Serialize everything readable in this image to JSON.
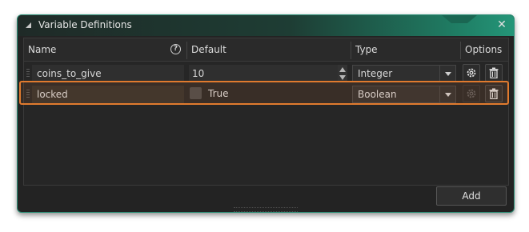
{
  "window": {
    "title": "Variable Definitions"
  },
  "table": {
    "columns": {
      "name": "Name",
      "default": "Default",
      "type": "Type",
      "options": "Options"
    },
    "rows": [
      {
        "name": "coins_to_give",
        "default": "10",
        "type": "Integer"
      },
      {
        "name": "locked",
        "default_checked": false,
        "default_label": "True",
        "type": "Boolean"
      }
    ]
  },
  "footer": {
    "add_label": "Add"
  },
  "icons": {
    "collapse": "collapse-triangle-icon",
    "close": "close-icon",
    "help": "help-icon",
    "drag": "drag-handle-icon",
    "dropdown": "chevron-down-icon",
    "spinner": "spinner-arrows-icon",
    "settings": "gear-icon",
    "delete": "trash-icon"
  },
  "colors": {
    "accent_teal": "#249578",
    "highlight_orange": "#e07a2e",
    "background": "#232323"
  }
}
